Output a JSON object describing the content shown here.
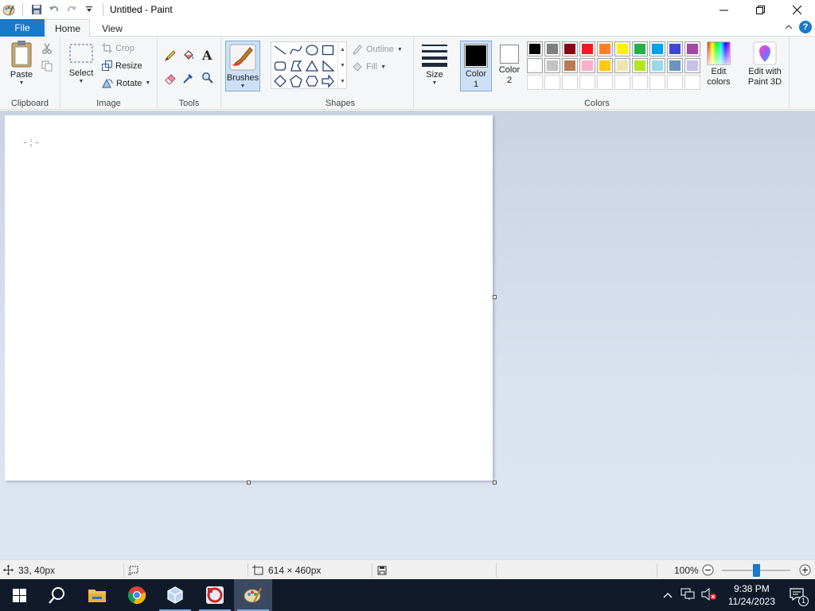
{
  "window": {
    "title": "Untitled - Paint"
  },
  "tabs": {
    "file": "File",
    "home": "Home",
    "view": "View"
  },
  "ribbon": {
    "clipboard": {
      "label": "Clipboard",
      "paste": "Paste"
    },
    "image": {
      "label": "Image",
      "select": "Select",
      "crop": "Crop",
      "resize": "Resize",
      "rotate": "Rotate"
    },
    "tools": {
      "label": "Tools"
    },
    "brushes": {
      "label": "Brushes"
    },
    "shapes": {
      "label": "Shapes",
      "outline": "Outline",
      "fill": "Fill"
    },
    "size": {
      "label": "Size"
    },
    "colors": {
      "label": "Colors",
      "color1_line1": "Color",
      "color1_line2": "1",
      "color2_line1": "Color",
      "color2_line2": "2",
      "edit_line1": "Edit",
      "edit_line2": "colors",
      "paint3d_line1": "Edit with",
      "paint3d_line2": "Paint 3D",
      "color1_value": "#000000",
      "color2_value": "#ffffff",
      "palette_row1": [
        "#000000",
        "#7f7f7f",
        "#880015",
        "#ed1c24",
        "#ff7f27",
        "#fff200",
        "#22b14c",
        "#00a2e8",
        "#3f48cc",
        "#a349a4"
      ],
      "palette_row2": [
        "#ffffff",
        "#c3c3c3",
        "#b97a57",
        "#ffaec9",
        "#ffc90e",
        "#efe4b0",
        "#b5e61d",
        "#99d9ea",
        "#7092be",
        "#c8bfe7"
      ]
    }
  },
  "statusbar": {
    "cursor_pos": "33, 40px",
    "canvas_size": "614 × 460px",
    "zoom": "100%"
  },
  "taskbar": {
    "time": "9:38 PM",
    "date": "11/24/2023",
    "notifications": "1"
  }
}
